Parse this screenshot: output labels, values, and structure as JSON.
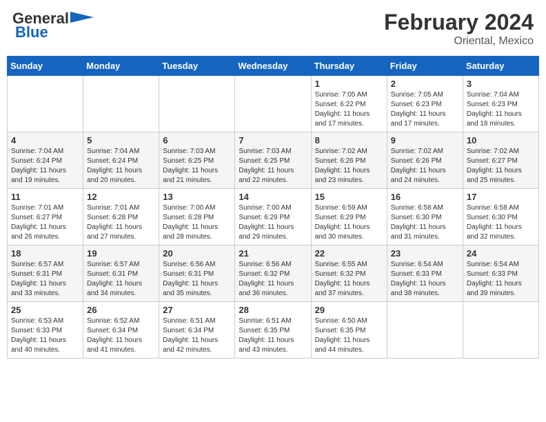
{
  "header": {
    "logo_line1": "General",
    "logo_line2": "Blue",
    "title": "February 2024",
    "subtitle": "Oriental, Mexico"
  },
  "weekdays": [
    "Sunday",
    "Monday",
    "Tuesday",
    "Wednesday",
    "Thursday",
    "Friday",
    "Saturday"
  ],
  "weeks": [
    [
      {
        "day": "",
        "info": ""
      },
      {
        "day": "",
        "info": ""
      },
      {
        "day": "",
        "info": ""
      },
      {
        "day": "",
        "info": ""
      },
      {
        "day": "1",
        "info": "Sunrise: 7:05 AM\nSunset: 6:22 PM\nDaylight: 11 hours and 17 minutes."
      },
      {
        "day": "2",
        "info": "Sunrise: 7:05 AM\nSunset: 6:23 PM\nDaylight: 11 hours and 17 minutes."
      },
      {
        "day": "3",
        "info": "Sunrise: 7:04 AM\nSunset: 6:23 PM\nDaylight: 11 hours and 18 minutes."
      }
    ],
    [
      {
        "day": "4",
        "info": "Sunrise: 7:04 AM\nSunset: 6:24 PM\nDaylight: 11 hours and 19 minutes."
      },
      {
        "day": "5",
        "info": "Sunrise: 7:04 AM\nSunset: 6:24 PM\nDaylight: 11 hours and 20 minutes."
      },
      {
        "day": "6",
        "info": "Sunrise: 7:03 AM\nSunset: 6:25 PM\nDaylight: 11 hours and 21 minutes."
      },
      {
        "day": "7",
        "info": "Sunrise: 7:03 AM\nSunset: 6:25 PM\nDaylight: 11 hours and 22 minutes."
      },
      {
        "day": "8",
        "info": "Sunrise: 7:02 AM\nSunset: 6:26 PM\nDaylight: 11 hours and 23 minutes."
      },
      {
        "day": "9",
        "info": "Sunrise: 7:02 AM\nSunset: 6:26 PM\nDaylight: 11 hours and 24 minutes."
      },
      {
        "day": "10",
        "info": "Sunrise: 7:02 AM\nSunset: 6:27 PM\nDaylight: 11 hours and 25 minutes."
      }
    ],
    [
      {
        "day": "11",
        "info": "Sunrise: 7:01 AM\nSunset: 6:27 PM\nDaylight: 11 hours and 26 minutes."
      },
      {
        "day": "12",
        "info": "Sunrise: 7:01 AM\nSunset: 6:28 PM\nDaylight: 11 hours and 27 minutes."
      },
      {
        "day": "13",
        "info": "Sunrise: 7:00 AM\nSunset: 6:28 PM\nDaylight: 11 hours and 28 minutes."
      },
      {
        "day": "14",
        "info": "Sunrise: 7:00 AM\nSunset: 6:29 PM\nDaylight: 11 hours and 29 minutes."
      },
      {
        "day": "15",
        "info": "Sunrise: 6:59 AM\nSunset: 6:29 PM\nDaylight: 11 hours and 30 minutes."
      },
      {
        "day": "16",
        "info": "Sunrise: 6:58 AM\nSunset: 6:30 PM\nDaylight: 11 hours and 31 minutes."
      },
      {
        "day": "17",
        "info": "Sunrise: 6:58 AM\nSunset: 6:30 PM\nDaylight: 11 hours and 32 minutes."
      }
    ],
    [
      {
        "day": "18",
        "info": "Sunrise: 6:57 AM\nSunset: 6:31 PM\nDaylight: 11 hours and 33 minutes."
      },
      {
        "day": "19",
        "info": "Sunrise: 6:57 AM\nSunset: 6:31 PM\nDaylight: 11 hours and 34 minutes."
      },
      {
        "day": "20",
        "info": "Sunrise: 6:56 AM\nSunset: 6:31 PM\nDaylight: 11 hours and 35 minutes."
      },
      {
        "day": "21",
        "info": "Sunrise: 6:56 AM\nSunset: 6:32 PM\nDaylight: 11 hours and 36 minutes."
      },
      {
        "day": "22",
        "info": "Sunrise: 6:55 AM\nSunset: 6:32 PM\nDaylight: 11 hours and 37 minutes."
      },
      {
        "day": "23",
        "info": "Sunrise: 6:54 AM\nSunset: 6:33 PM\nDaylight: 11 hours and 38 minutes."
      },
      {
        "day": "24",
        "info": "Sunrise: 6:54 AM\nSunset: 6:33 PM\nDaylight: 11 hours and 39 minutes."
      }
    ],
    [
      {
        "day": "25",
        "info": "Sunrise: 6:53 AM\nSunset: 6:33 PM\nDaylight: 11 hours and 40 minutes."
      },
      {
        "day": "26",
        "info": "Sunrise: 6:52 AM\nSunset: 6:34 PM\nDaylight: 11 hours and 41 minutes."
      },
      {
        "day": "27",
        "info": "Sunrise: 6:51 AM\nSunset: 6:34 PM\nDaylight: 11 hours and 42 minutes."
      },
      {
        "day": "28",
        "info": "Sunrise: 6:51 AM\nSunset: 6:35 PM\nDaylight: 11 hours and 43 minutes."
      },
      {
        "day": "29",
        "info": "Sunrise: 6:50 AM\nSunset: 6:35 PM\nDaylight: 11 hours and 44 minutes."
      },
      {
        "day": "",
        "info": ""
      },
      {
        "day": "",
        "info": ""
      }
    ]
  ]
}
